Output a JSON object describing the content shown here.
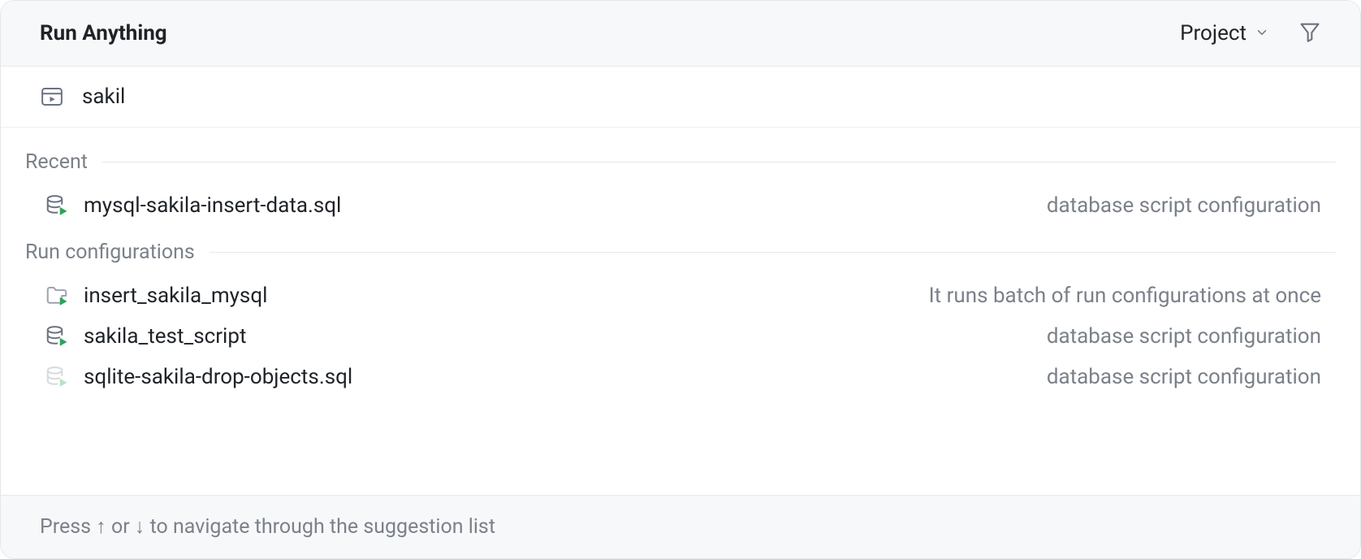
{
  "header": {
    "title": "Run Anything",
    "scope_label": "Project"
  },
  "search": {
    "value": "sakil"
  },
  "sections": [
    {
      "label": "Recent",
      "items": [
        {
          "icon": "db-run",
          "label": "mysql-sakila-insert-data.sql",
          "desc": "database script configuration"
        }
      ]
    },
    {
      "label": "Run configurations",
      "items": [
        {
          "icon": "folder-run",
          "label": "insert_sakila_mysql",
          "desc": "It runs batch of run configurations at once"
        },
        {
          "icon": "db-run",
          "label": "sakila_test_script",
          "desc": "database script configuration"
        },
        {
          "icon": "db-run-dim",
          "label": "sqlite-sakila-drop-objects.sql",
          "desc": "database script configuration"
        }
      ]
    }
  ],
  "footer": {
    "hint": "Press ↑ or ↓ to navigate through the suggestion list"
  }
}
